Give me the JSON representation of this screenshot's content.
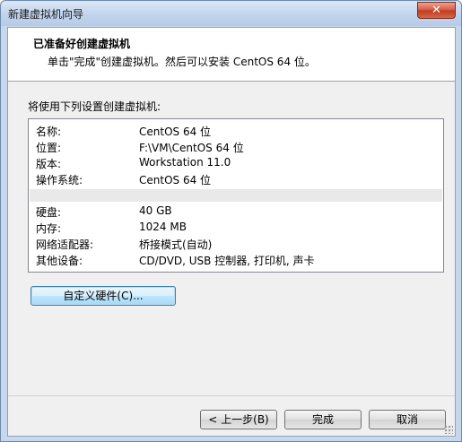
{
  "window": {
    "title": "新建虚拟机向导",
    "close_glyph": "✕"
  },
  "header": {
    "title": "已准备好创建虚拟机",
    "subtitle": "单击\"完成\"创建虚拟机。然后可以安装 CentOS 64 位。"
  },
  "summary": {
    "label": "将使用下列设置创建虚拟机:",
    "rows_top": [
      {
        "key": "名称:",
        "value": "CentOS 64 位"
      },
      {
        "key": "位置:",
        "value": "F:\\VM\\CentOS 64 位"
      },
      {
        "key": "版本:",
        "value": "Workstation 11.0"
      },
      {
        "key": "操作系统:",
        "value": "CentOS 64 位"
      }
    ],
    "rows_bottom": [
      {
        "key": "硬盘:",
        "value": "40 GB"
      },
      {
        "key": "内存:",
        "value": "1024 MB"
      },
      {
        "key": "网络适配器:",
        "value": "桥接模式(自动)"
      },
      {
        "key": "其他设备:",
        "value": "CD/DVD, USB 控制器, 打印机, 声卡"
      }
    ]
  },
  "buttons": {
    "customize_hardware": "自定义硬件(C)...",
    "back": "< 上一步(B)",
    "finish": "完成",
    "cancel": "取消"
  }
}
